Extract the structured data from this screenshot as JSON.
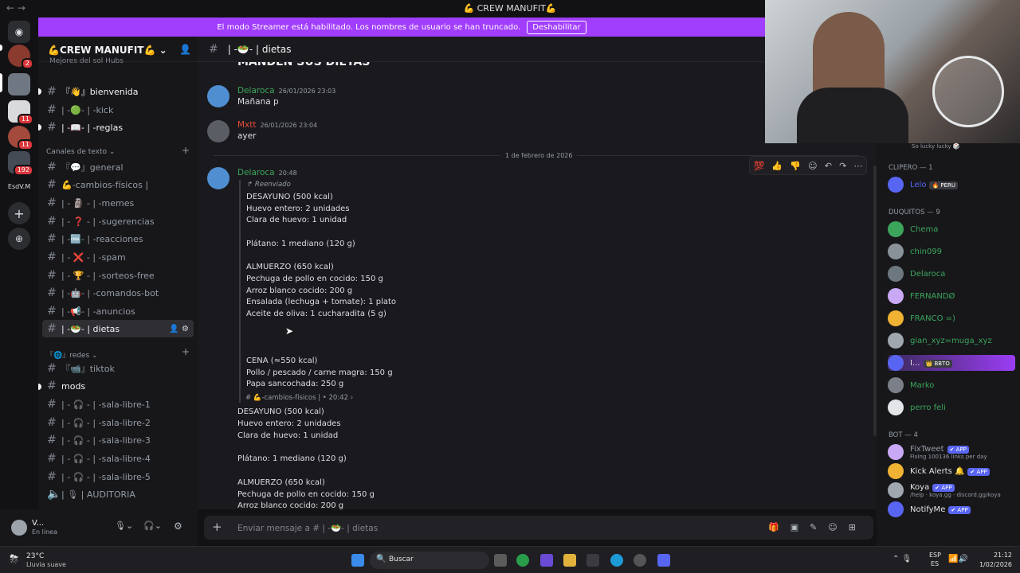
{
  "window": {
    "title": "💪 CREW MANUFIT💪",
    "nav": "←  →"
  },
  "streamer": {
    "text": "El modo Streamer está habilitado. Los nombres de usuario se han truncado.",
    "button": "Deshabilitar"
  },
  "servers": {
    "badges": [
      "2",
      "11",
      "11",
      "192"
    ],
    "label": "EsdV.M"
  },
  "sidebar": {
    "server_name": "💪CREW MANUFIT💪",
    "top_partial": "Mejores del sol Hubs",
    "channels_top": [
      {
        "label": "『👋』bienvenida"
      },
      {
        "label": "| -🟢- | -kick"
      },
      {
        "label": "| -📖- | -reglas"
      }
    ],
    "category_text": "Canales de texto",
    "text_channels": [
      {
        "label": "『💬』general"
      },
      {
        "label": "💪-cambios-físicos |"
      },
      {
        "label": "| - 🗿 - | -memes"
      },
      {
        "label": "| - ❓ - | -sugerencias"
      },
      {
        "label": "| -🆒- | -reacciones"
      },
      {
        "label": "| - ❌ - | -spam"
      },
      {
        "label": "| - 🏆 - | -sorteos-free"
      },
      {
        "label": "| -🤖- | -comandos-bot"
      },
      {
        "label": "| -📢- | -anuncios"
      },
      {
        "label": "| -🥗- | dietas"
      }
    ],
    "category_redes": "『🌐』redes",
    "redes_channels": [
      {
        "label": "『📹』tiktok"
      }
    ],
    "mods_label": "mods",
    "voice_channels": [
      {
        "label": "| - 🎧 - | -sala-libre-1"
      },
      {
        "label": "| - 🎧 - | -sala-libre-2"
      },
      {
        "label": "| - 🎧 - | -sala-libre-3"
      },
      {
        "label": "| - 🎧 - | -sala-libre-4"
      },
      {
        "label": "| - 🎧 - | -sala-libre-5"
      },
      {
        "label": "|  🎙  |  AUDITORIA"
      }
    ]
  },
  "user": {
    "name": "V...",
    "status": "En línea"
  },
  "chat": {
    "channel": "| -🥗- | dietas",
    "partial_heading": "MANDEN SUS DIETAS",
    "date_divider": "1 de febrero de 2026",
    "messages": [
      {
        "author": "Delaroca",
        "time": "26/01/2026 23:03",
        "text": "Mañana p",
        "color": "#3ba55c"
      },
      {
        "author": "Mxtt",
        "time": "26/01/2026 23:04",
        "text": "ayer",
        "color": "#e74c3c"
      },
      {
        "author": "Delaroca",
        "time": "20:48",
        "color": "#3ba55c"
      }
    ],
    "forwarded_label": "Reenviado",
    "forwarded_lines": [
      "DESAYUNO (500 kcal)",
      "Huevo entero: 2 unidades",
      "Clara de huevo: 1 unidad",
      "",
      "Plátano: 1 mediano (120 g)",
      "",
      "ALMUERZO (650 kcal)",
      "Pechuga de pollo en cocido: 150 g",
      "Arroz blanco cocido: 200 g",
      "Ensalada (lechuga + tomate): 1 plato",
      "Aceite de oliva: 1 cucharadita (5 g)",
      "",
      "",
      "",
      "CENA (≈550 kcal)",
      "Pollo / pescado / carne magra: 150 g",
      "Papa sancochada: 250 g"
    ],
    "forwarded_source": "# 💪-cambios-físicos |  •  20:42  ›",
    "body_lines": [
      "DESAYUNO (500 kcal)",
      "Huevo entero: 2 unidades",
      "Clara de huevo: 1 unidad",
      "",
      "Plátano: 1 mediano (120 g)",
      "",
      "ALMUERZO (650 kcal)",
      "Pechuga de pollo en cocido: 150 g",
      "Arroz blanco cocido: 200 g"
    ],
    "composer_placeholder": "Enviar mensaje a # | -🥗- | dietas"
  },
  "members": {
    "partial_top": "So lucky lucky 🎲",
    "groups": [
      {
        "title": "CLIPERO — 1",
        "items": [
          {
            "name": "Lelo",
            "tag": "🔥 PERU",
            "color": "#5865f2"
          }
        ]
      },
      {
        "title": "DUQUITOS — 9",
        "items": [
          {
            "name": "Chema",
            "color": "#3ba55c"
          },
          {
            "name": "chin099",
            "color": "#3ba55c"
          },
          {
            "name": "Delaroca",
            "color": "#3ba55c"
          },
          {
            "name": "FERNANDØ",
            "color": "#3ba55c"
          },
          {
            "name": "FRANCO =)",
            "color": "#3ba55c"
          },
          {
            "name": "gian_xyz=muga_xyz",
            "color": "#3ba55c"
          },
          {
            "name": "I...",
            "tag": "👑 BBTO",
            "color": "#e3e5e8"
          },
          {
            "name": "Marko",
            "color": "#3ba55c"
          },
          {
            "name": "perro feli",
            "color": "#3ba55c"
          }
        ]
      },
      {
        "title": "BOT — 4",
        "items": [
          {
            "name": "FixTweet",
            "tag": "✔ APP",
            "sub": "Fixing 100136 links per day",
            "color": "#949ba4"
          },
          {
            "name": "Kick Alerts 🔔",
            "tag": "✔ APP",
            "color": "#e3e5e8"
          },
          {
            "name": "Koya",
            "tag": "✔ APP",
            "sub": "/help · koya.gg · discord.gg/koya",
            "color": "#e3e5e8"
          },
          {
            "name": "NotifyMe",
            "tag": "✔ APP",
            "color": "#e3e5e8"
          }
        ]
      }
    ]
  },
  "taskbar": {
    "weather_temp": "23°C",
    "weather_desc": "Lluvia suave",
    "search": "Buscar",
    "lang1": "ESP",
    "lang2": "ES",
    "time": "21:12",
    "date": "1/02/2026"
  }
}
